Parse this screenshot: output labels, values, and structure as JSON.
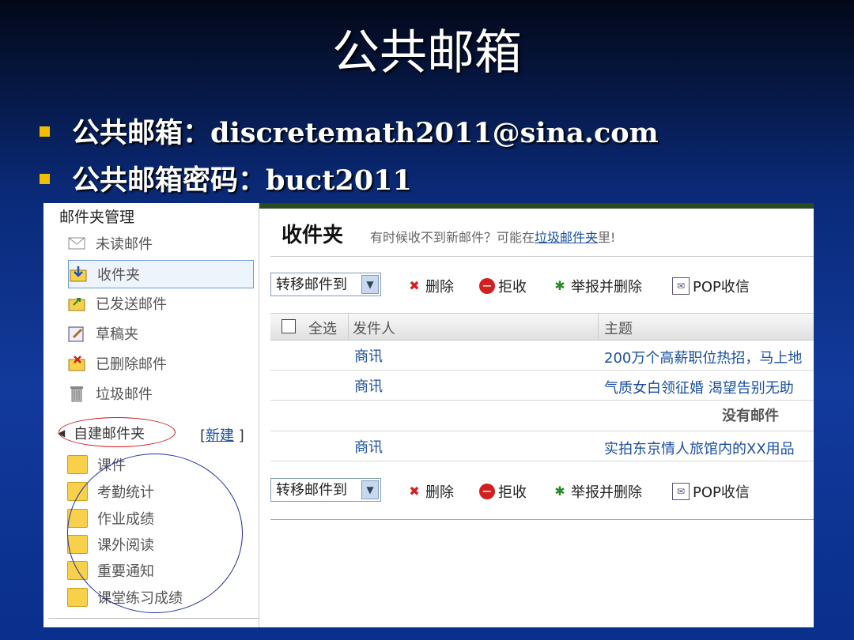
{
  "slide": {
    "title": "公共邮箱",
    "bullets": [
      "公共邮箱：discretemath2011@sina.com",
      "公共邮箱密码：buct2011"
    ]
  },
  "sidebar": {
    "header": "邮件夹管理",
    "system_folders": [
      {
        "label": "未读邮件",
        "icon": "envelope-icon"
      },
      {
        "label": "收件夹",
        "icon": "inbox-icon"
      },
      {
        "label": "已发送邮件",
        "icon": "sent-icon"
      },
      {
        "label": "草稿夹",
        "icon": "draft-icon"
      },
      {
        "label": "已删除邮件",
        "icon": "deleted-icon"
      },
      {
        "label": "垃圾邮件",
        "icon": "trash-icon"
      }
    ],
    "custom_header": "自建邮件夹",
    "new_link": "新建",
    "new_bracket_open": "[",
    "new_bracket_close": "]",
    "custom_folders": [
      "课件",
      "考勤统计",
      "作业成绩",
      "课外阅读",
      "重要通知",
      "课堂练习成绩"
    ]
  },
  "main": {
    "title": "收件夹",
    "hint_prefix": "有时候收不到新邮件？可能在",
    "hint_link": "垃圾邮件夹",
    "hint_suffix": "里!",
    "toolbar": {
      "move_to": "转移邮件到",
      "delete": "删除",
      "reject": "拒收",
      "report_delete": "举报并删除",
      "pop": "POP收信"
    },
    "columns": {
      "select_all": "全选",
      "sender": "发件人",
      "subject": "主题"
    },
    "rows": [
      {
        "sender": "商讯",
        "subject": "200万个高薪职位热招，马上地"
      },
      {
        "sender": "商讯",
        "subject": "气质女白领征婚 渴望告别无助"
      },
      {
        "sender": "商讯",
        "subject": "实拍东京情人旅馆内的XX用品"
      }
    ],
    "empty_text": "没有邮件"
  },
  "colors": {
    "accent_yellow": "#f0c000",
    "link_blue": "#1a4fa0",
    "highlight_red": "#d01010",
    "circle_blue": "#2030a0"
  }
}
